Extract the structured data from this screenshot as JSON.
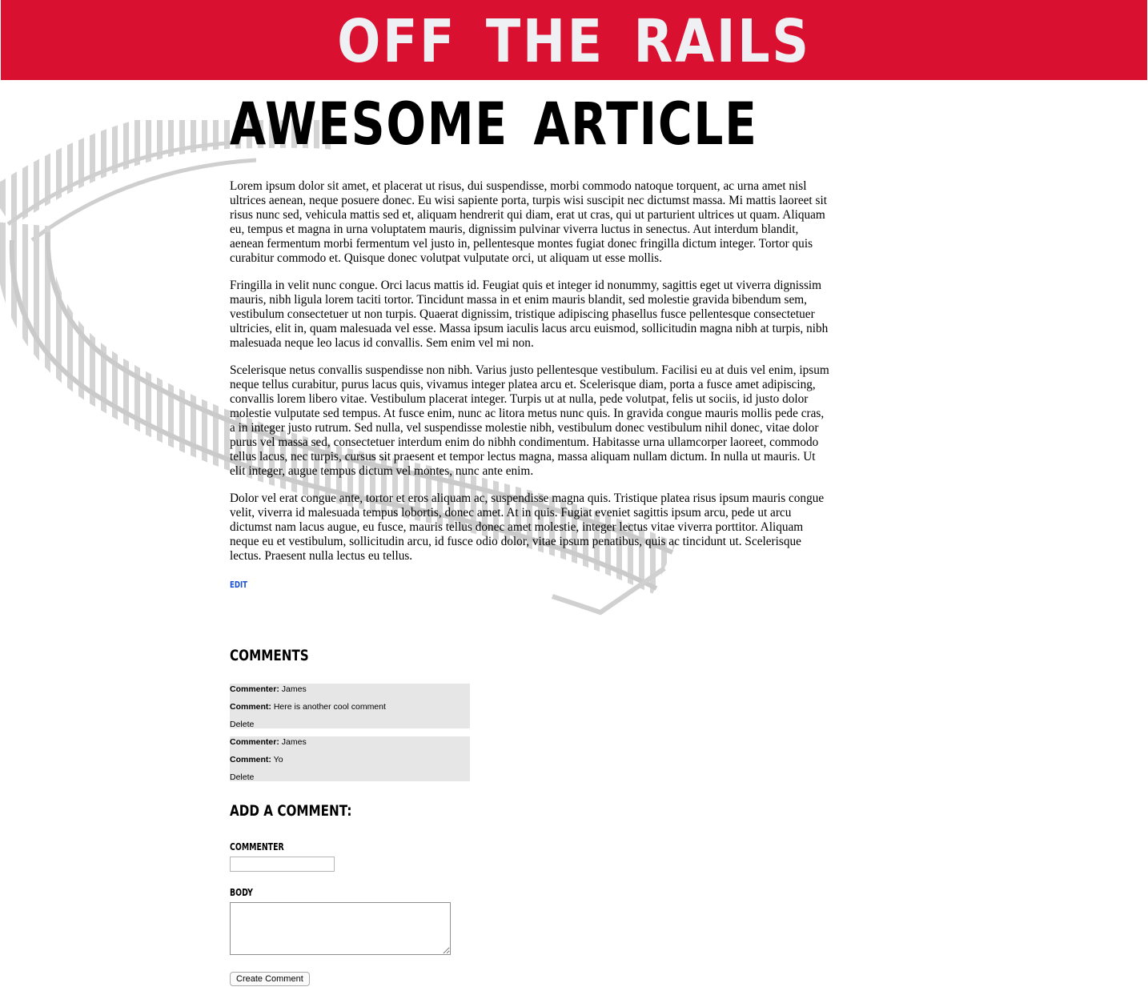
{
  "header": {
    "site_title": "Off the Rails",
    "background_color": "#d91030",
    "title_color": "#eef0f4"
  },
  "article": {
    "title": "Awesome Article",
    "paragraphs": [
      "Lorem ipsum dolor sit amet, et placerat ut risus, dui suspendisse, morbi commodo natoque torquent, ac urna amet nisl ultrices aenean, neque posuere donec. Eu wisi sapiente porta, turpis wisi suscipit nec dictumst massa. Mi mattis laoreet sit risus nunc sed, vehicula mattis sed et, aliquam hendrerit qui diam, erat ut cras, qui ut parturient ultrices ut quam. Aliquam eu, tempus et magna in urna voluptatem mauris, dignissim pulvinar viverra luctus in senectus. Aut interdum blandit, aenean fermentum morbi fermentum vel justo in, pellentesque montes fugiat donec fringilla dictum integer. Tortor quis curabitur commodo et. Quisque donec volutpat vulputate orci, ut aliquam ut esse mollis.",
      "Fringilla in velit nunc congue. Orci lacus mattis id. Feugiat quis et integer id nonummy, sagittis eget ut viverra dignissim mauris, nibh ligula lorem taciti tortor. Tincidunt massa in et enim mauris blandit, sed molestie gravida bibendum sem, vestibulum consectetuer ut non turpis. Quaerat dignissim, tristique adipiscing phasellus fusce pellentesque consectetuer ultricies, elit in, quam malesuada vel esse. Massa ipsum iaculis lacus arcu euismod, sollicitudin magna nibh at turpis, nibh malesuada neque leo lacus id convallis. Sem enim vel mi non.",
      "Scelerisque netus convallis suspendisse non nibh. Varius justo pellentesque vestibulum. Facilisi eu at duis vel enim, ipsum neque tellus curabitur, purus lacus quis, vivamus integer platea arcu et. Scelerisque diam, porta a fusce amet adipiscing, convallis lorem libero vitae. Vestibulum placerat integer. Turpis ut at nulla, pede volutpat, felis ut sociis, id justo dolor molestie vulputate sed tempus. At fusce enim, nunc ac litora metus nunc quis. In gravida congue mauris mollis pede cras, a in integer justo rutrum. Sed nulla, vel suspendisse molestie nibh, vestibulum donec vestibulum nihil donec, vitae dolor purus vel massa sed, consectetuer interdum enim do nibhh condimentum. Habitasse urna ullamcorper laoreet, commodo tellus lacus, nec turpis, cursus sit praesent et tempor lectus magna, massa aliquam nullam dictum. In nulla ut mauris. Ut elit integer, augue tempus dictum vel montes, nunc ante enim.",
      "Dolor vel erat congue ante, tortor et eros aliquam ac, suspendisse magna quis. Tristique platea risus ipsum mauris congue velit, viverra id malesuada tempus lobortis, donec amet. At in quis. Fugiat eveniet sagittis ipsum arcu, pede ut arcu dictumst nam lacus augue, eu fusce, mauris tellus donec amet molestie, integer lectus vitae viverra porttitor. Aliquam neque eu et vestibulum, sollicitudin arcu, id fusce odio dolor, vitae ipsum penatibus, quis ac tincidunt ut. Scelerisque lectus. Praesent nulla lectus eu tellus."
    ],
    "edit_label": "Edit",
    "link_color": "#1a4fd1"
  },
  "comments": {
    "heading": "Comments",
    "commenter_label": "Commenter:",
    "comment_label": "Comment:",
    "delete_label": "Delete",
    "card_color": "#e6e6e6",
    "items": [
      {
        "commenter": "James",
        "comment": "Here is another cool comment"
      },
      {
        "commenter": "James",
        "comment": "Yo"
      }
    ]
  },
  "form": {
    "heading": "Add a Comment:",
    "commenter_label": "Commenter",
    "commenter_value": "",
    "body_label": "Body",
    "body_value": "",
    "submit_label": "Create Comment"
  }
}
